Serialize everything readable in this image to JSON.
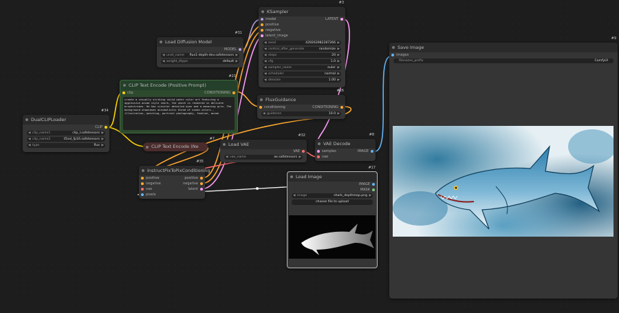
{
  "nodes": {
    "ksampler": {
      "badge": "#3",
      "title": "KSampler",
      "inputs": [
        "model",
        "positive",
        "negative",
        "latent_image"
      ],
      "output": "LATENT",
      "widgets": [
        {
          "label": "seed",
          "value": "429263982287266"
        },
        {
          "label": "control_after_generate",
          "value": "randomize"
        },
        {
          "label": "steps",
          "value": "20"
        },
        {
          "label": "cfg",
          "value": "1.0"
        },
        {
          "label": "sampler_name",
          "value": "euler"
        },
        {
          "label": "scheduler",
          "value": "normal"
        },
        {
          "label": "denoise",
          "value": "1.00"
        }
      ]
    },
    "load_diffusion": {
      "badge": "#31",
      "title": "Load Diffusion Model",
      "output": "MODEL",
      "widgets": [
        {
          "label": "unet_name",
          "value": "flux1-depth-dev.safetensors"
        },
        {
          "label": "weight_dtype",
          "value": "default"
        }
      ]
    },
    "clip_pos": {
      "badge": "#23",
      "title": "CLIP Text Encode (Positive Prompt)",
      "input": "clip",
      "output": "CONDITIONING",
      "text": "create a visually striking shiid water color art featuring a aggressive anime style shark, the shark is rendered in delicate brushstrokes. He has sinister detailed eyes and a menacing grin. The background showcases minimalistic blend of ocean colors., illustration, painting, portrait photography, fashion, anime"
    },
    "flux_guidance": {
      "badge": "#26",
      "title": "FluxGuidance",
      "input": "conditioning",
      "output": "CONDITIONING",
      "widget": {
        "label": "guidance",
        "value": "10.0"
      }
    },
    "dual_clip": {
      "badge": "#34",
      "title": "DualCLIPLoader",
      "output": "CLIP",
      "widgets": [
        {
          "label": "clip_name1",
          "value": "clip_l.safetensors"
        },
        {
          "label": "clip_name2",
          "value": "t5xxl_fp16.safetensors"
        },
        {
          "label": "type",
          "value": "flux"
        }
      ]
    },
    "clip_neg": {
      "badge": "#7",
      "title": "CLIP Text Encode (Ne"
    },
    "load_vae": {
      "badge": "#32",
      "title": "Load VAE",
      "output": "VAE",
      "widget": {
        "label": "vae_name",
        "value": "ae.safetensors"
      }
    },
    "vae_decode": {
      "badge": "#8",
      "title": "VAE Decode",
      "inputs": [
        "samples",
        "vae"
      ],
      "output": "IMAGE"
    },
    "instruct": {
      "badge": "#35",
      "title": "InstructPixToPixConditioning",
      "inputs": [
        "positive",
        "negative",
        "vae",
        "pixels"
      ],
      "outputs": [
        "positive",
        "negative",
        "latent"
      ]
    },
    "load_image": {
      "badge": "#17",
      "title": "Load Image",
      "outputs": [
        "IMAGE",
        "MASK"
      ],
      "widget": {
        "label": "image",
        "value": "shark_depthmap.png"
      },
      "button": "choose file to upload"
    },
    "save_image": {
      "badge": "#9",
      "title": "Save Image",
      "input": "images",
      "widget": {
        "label": "filename_prefix",
        "value": "ComfyUI"
      }
    }
  },
  "colors": {
    "model": "#b39ddb",
    "conditioning": "#ffa931",
    "clip": "#ffd500",
    "vae": "#ff6e6e",
    "latent": "#ff9cf9",
    "image": "#64b5f6",
    "mask": "#81c784",
    "positive_node": "#2e4a2e"
  }
}
